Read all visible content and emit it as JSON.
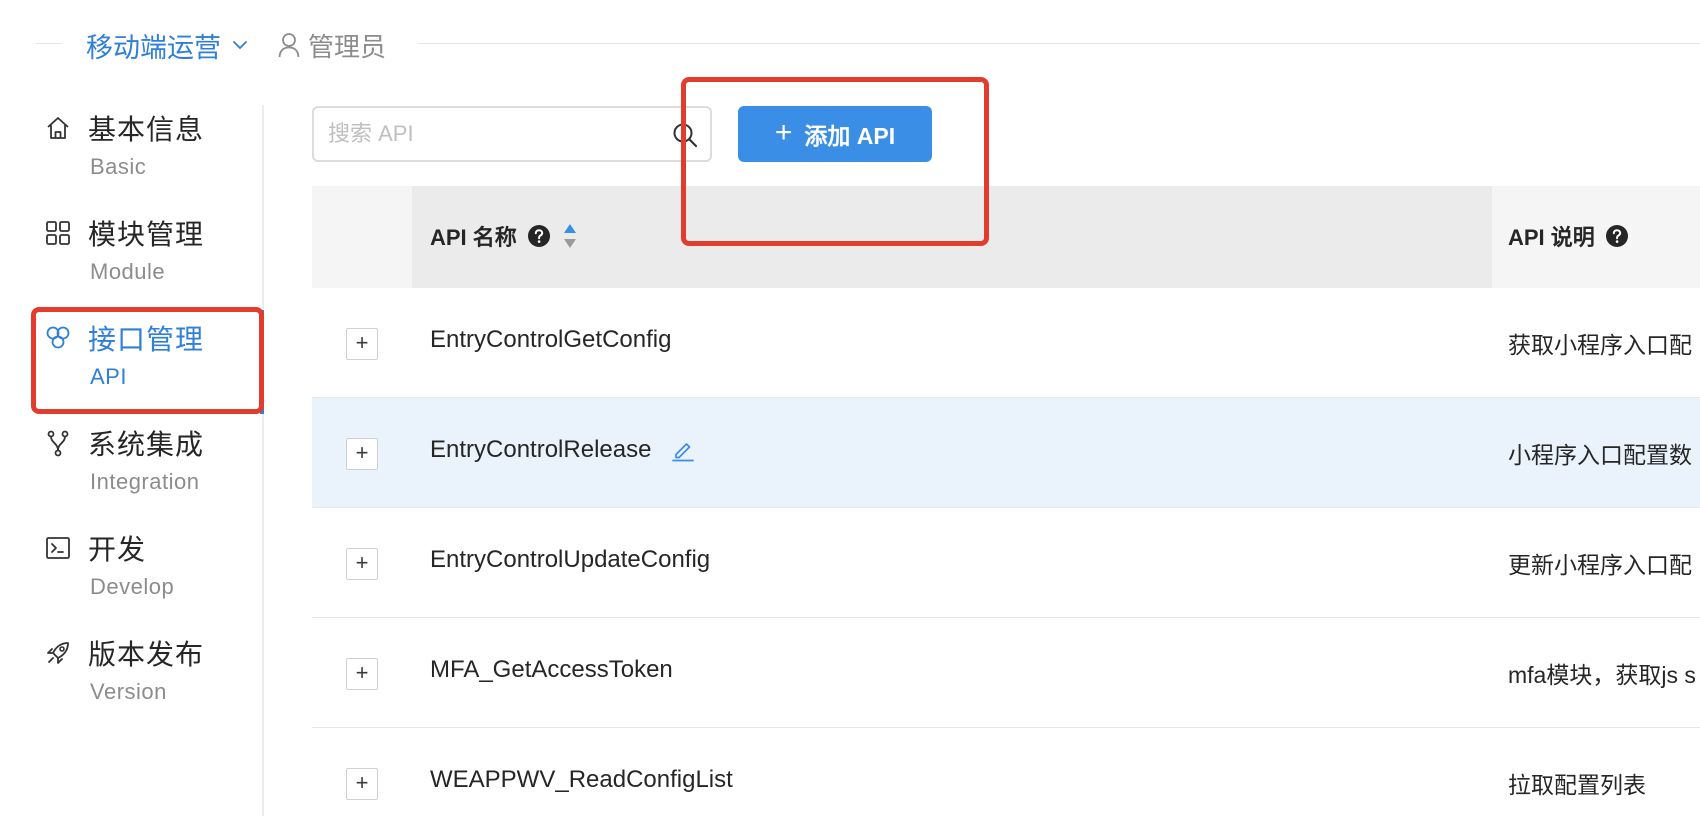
{
  "header": {
    "app_name": "移动端运营",
    "role": "管理员"
  },
  "sidebar": {
    "items": [
      {
        "title": "基本信息",
        "subtitle": "Basic",
        "icon": "home-icon"
      },
      {
        "title": "模块管理",
        "subtitle": "Module",
        "icon": "grid-icon"
      },
      {
        "title": "接口管理",
        "subtitle": "API",
        "icon": "cubes-icon",
        "active": true
      },
      {
        "title": "系统集成",
        "subtitle": "Integration",
        "icon": "branch-icon"
      },
      {
        "title": "开发",
        "subtitle": "Develop",
        "icon": "terminal-icon"
      },
      {
        "title": "版本发布",
        "subtitle": "Version",
        "icon": "rocket-icon"
      }
    ]
  },
  "toolbar": {
    "search_placeholder": "搜索 API",
    "add_button_label": "添加 API"
  },
  "table": {
    "columns": [
      {
        "label": "API 名称",
        "has_help": true,
        "sortable": true
      },
      {
        "label": "API 说明",
        "has_help": true
      }
    ],
    "rows": [
      {
        "name": "EntryControlGetConfig",
        "description": "获取小程序入口配"
      },
      {
        "name": "EntryControlRelease",
        "description": "小程序入口配置数",
        "highlighted": true,
        "editable": true
      },
      {
        "name": "EntryControlUpdateConfig",
        "description": "更新小程序入口配"
      },
      {
        "name": "MFA_GetAccessToken",
        "description": "mfa模块，获取js s"
      },
      {
        "name": "WEAPPWV_ReadConfigList",
        "description": "拉取配置列表"
      }
    ]
  },
  "colors": {
    "accent": "#2f7fd9",
    "button": "#3a8ee6",
    "annotation": "#e23c2e",
    "row_highlight": "#eaf2fb"
  }
}
